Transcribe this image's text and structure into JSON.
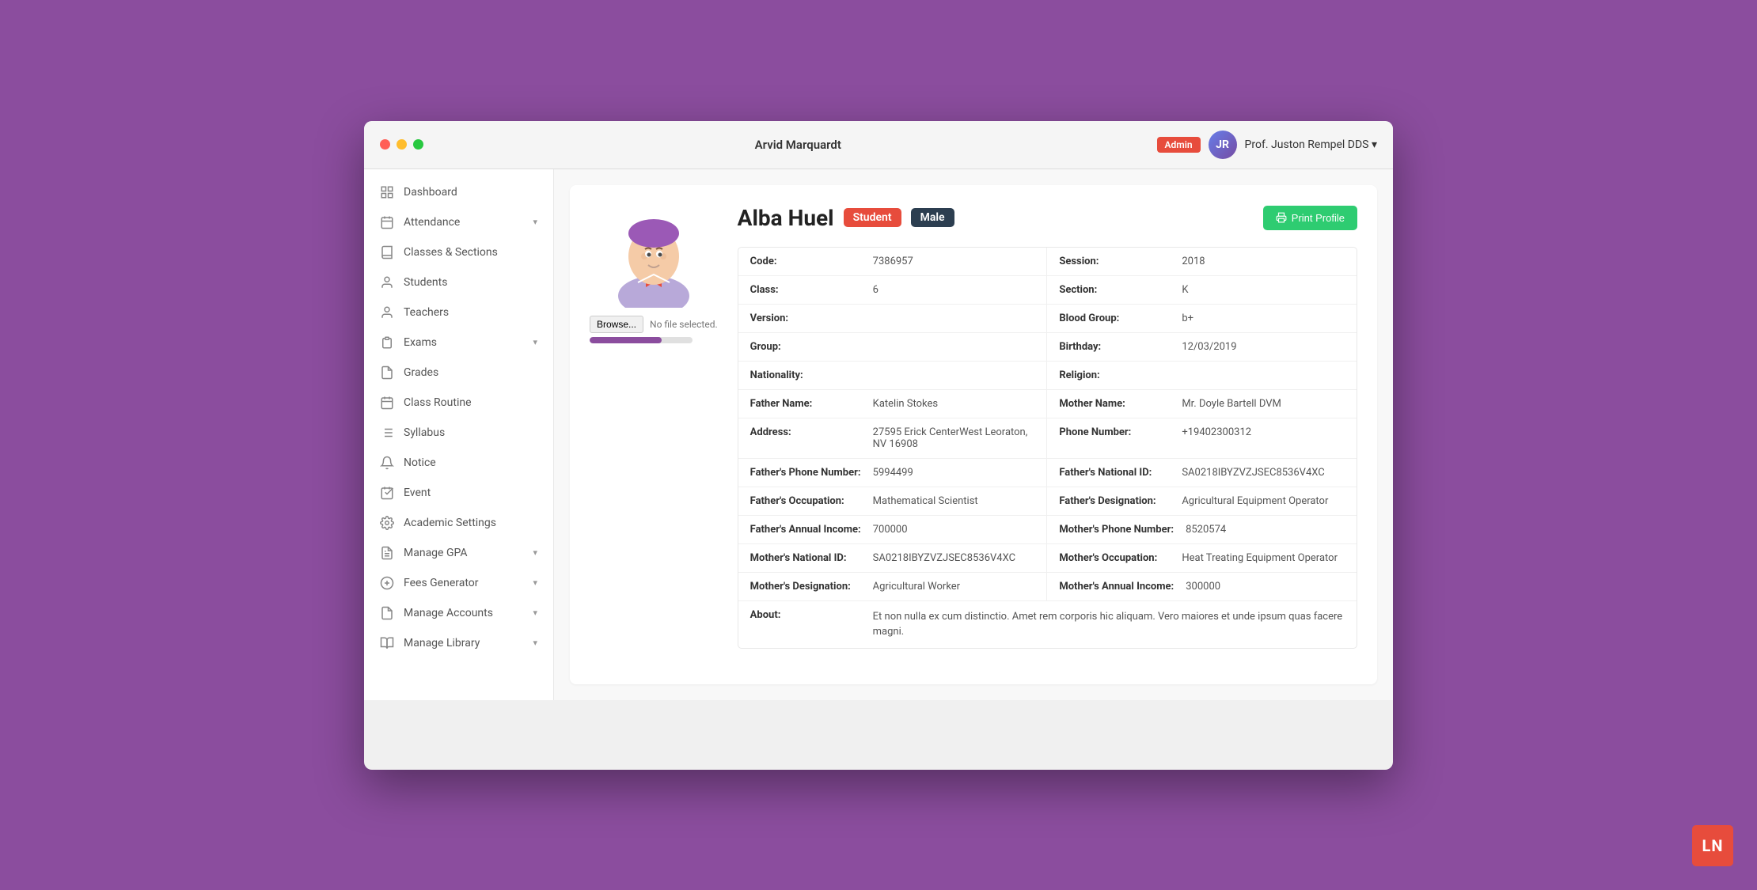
{
  "window": {
    "title": "Arvid Marquardt"
  },
  "header": {
    "admin_badge": "Admin",
    "user_name": "Prof. Juston Rempel DDS",
    "dropdown_icon": "▾"
  },
  "sidebar": {
    "items": [
      {
        "id": "dashboard",
        "label": "Dashboard",
        "icon": "grid",
        "has_chevron": false
      },
      {
        "id": "attendance",
        "label": "Attendance",
        "icon": "calendar",
        "has_chevron": true
      },
      {
        "id": "classes-sections",
        "label": "Classes & Sections",
        "icon": "book",
        "has_chevron": false
      },
      {
        "id": "students",
        "label": "Students",
        "icon": "user",
        "has_chevron": false
      },
      {
        "id": "teachers",
        "label": "Teachers",
        "icon": "user-tie",
        "has_chevron": false
      },
      {
        "id": "exams",
        "label": "Exams",
        "icon": "clipboard",
        "has_chevron": true
      },
      {
        "id": "grades",
        "label": "Grades",
        "icon": "file",
        "has_chevron": false
      },
      {
        "id": "class-routine",
        "label": "Class Routine",
        "icon": "calendar-alt",
        "has_chevron": false
      },
      {
        "id": "syllabus",
        "label": "Syllabus",
        "icon": "list",
        "has_chevron": false
      },
      {
        "id": "notice",
        "label": "Notice",
        "icon": "bell",
        "has_chevron": false
      },
      {
        "id": "event",
        "label": "Event",
        "icon": "calendar-check",
        "has_chevron": false
      },
      {
        "id": "academic-settings",
        "label": "Academic Settings",
        "icon": "cog",
        "has_chevron": false
      },
      {
        "id": "manage-gpa",
        "label": "Manage GPA",
        "icon": "file-alt",
        "has_chevron": true
      },
      {
        "id": "fees-generator",
        "label": "Fees Generator",
        "icon": "dollar",
        "has_chevron": true
      },
      {
        "id": "manage-accounts",
        "label": "Manage Accounts",
        "icon": "file-invoice",
        "has_chevron": true
      },
      {
        "id": "manage-library",
        "label": "Manage Library",
        "icon": "book-open",
        "has_chevron": true
      }
    ]
  },
  "student": {
    "name": "Alba Huel",
    "badge_type": "Student",
    "badge_gender": "Male",
    "code_label": "Code:",
    "code_value": "7386957",
    "session_label": "Session:",
    "session_value": "2018",
    "class_label": "Class:",
    "class_value": "6",
    "section_label": "Section:",
    "section_value": "K",
    "version_label": "Version:",
    "version_value": "",
    "blood_group_label": "Blood Group:",
    "blood_group_value": "b+",
    "group_label": "Group:",
    "group_value": "",
    "birthday_label": "Birthday:",
    "birthday_value": "12/03/2019",
    "nationality_label": "Nationality:",
    "nationality_value": "",
    "religion_label": "Religion:",
    "religion_value": "",
    "father_name_label": "Father Name:",
    "father_name_value": "Katelin Stokes",
    "mother_name_label": "Mother Name:",
    "mother_name_value": "Mr. Doyle Bartell DVM",
    "address_label": "Address:",
    "address_value": "27595 Erick CenterWest Leoraton, NV 16908",
    "phone_label": "Phone Number:",
    "phone_value": "+19402300312",
    "father_phone_label": "Father's Phone Number:",
    "father_phone_value": "5994499",
    "father_national_id_label": "Father's National ID:",
    "father_national_id_value": "SA0218IBYZVZJSEC8536V4XC",
    "father_occupation_label": "Father's Occupation:",
    "father_occupation_value": "Mathematical Scientist",
    "father_designation_label": "Father's Designation:",
    "father_designation_value": "Agricultural Equipment Operator",
    "father_income_label": "Father's Annual Income:",
    "father_income_value": "700000",
    "mother_phone_label": "Mother's Phone Number:",
    "mother_phone_value": "8520574",
    "mother_national_id_label": "Mother's National ID:",
    "mother_national_id_value": "SA0218IBYZVZJSEC8536V4XC",
    "mother_occupation_label": "Mother's Occupation:",
    "mother_occupation_value": "Heat Treating Equipment Operator",
    "mother_designation_label": "Mother's Designation:",
    "mother_designation_value": "Agricultural Worker",
    "mother_income_label": "Mother's Annual Income:",
    "mother_income_value": "300000",
    "about_label": "About:",
    "about_value": "Et non nulla ex cum distinctio. Amet rem corporis hic aliquam. Vero maiores et unde ipsum quas facere magni.",
    "print_profile_label": "Print Profile",
    "browse_label": "Browse...",
    "no_file_label": "No file selected."
  },
  "ln_badge": "LN"
}
